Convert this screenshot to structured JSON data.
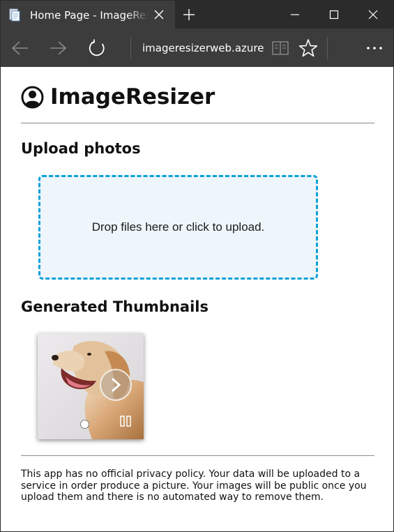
{
  "browser": {
    "tab_title": "Home Page - ImageResizer",
    "address": "imageresizerweb.azure",
    "icons": {
      "favicon": "page-icon",
      "tab_close": "close-icon",
      "new_tab": "plus-icon",
      "back": "arrow-left-icon",
      "forward": "arrow-right-icon",
      "refresh": "refresh-icon",
      "reading_view": "book-icon",
      "favorite": "star-icon",
      "more": "ellipsis-icon",
      "minimize": "minimize-icon",
      "maximize": "maximize-icon",
      "close": "close-icon"
    }
  },
  "page": {
    "brand": {
      "name": "ImageResizer",
      "icon": "user-circle-icon"
    },
    "upload": {
      "heading": "Upload photos",
      "dropzone_message": "Drop files here or click to upload.",
      "border_color": "#0ca1d8",
      "background_color": "#eef6fc"
    },
    "thumbnails": {
      "heading": "Generated Thumbnails",
      "items": [
        {
          "subject": "golden retriever dog",
          "icons": [
            "play-icon",
            "pause-icon"
          ]
        }
      ]
    },
    "footer": {
      "privacy_note": "This app has no official privacy policy. Your data will be uploaded to a service in order produce a picture. Your images will be public once you upload them and there is no automated way to remove them."
    }
  },
  "colors": {
    "chrome_dark": "#2b2b2b",
    "chrome_tab": "#3c3c3c",
    "text": "#111111"
  }
}
